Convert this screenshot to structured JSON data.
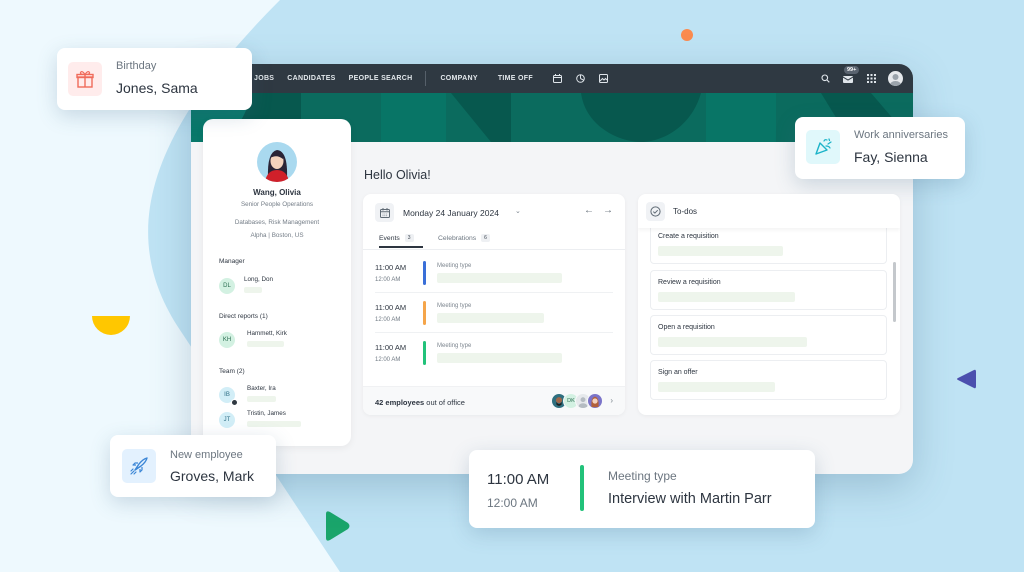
{
  "app": {
    "nav": [
      "JOBS",
      "CANDIDATES",
      "PEOPLE SEARCH",
      "COMPANY",
      "TIME OFF"
    ],
    "nav_icons": [
      "calendar-icon",
      "chart-icon",
      "gallery-icon"
    ],
    "inbox_badge": "99+",
    "colors": {
      "topbar": "#2f3942",
      "banner": "#0b6b5e",
      "event_blue": "#3a6fd8",
      "event_orange": "#f5a54a",
      "event_green": "#22c27a"
    }
  },
  "profile": {
    "name": "Wang, Olivia",
    "title": "Senior People Operations",
    "departments": "Databases, Risk Management",
    "location": "Alpha | Boston, US",
    "manager_label": "Manager",
    "manager": {
      "initials": "DL",
      "name": "Long, Don"
    },
    "direct_reports_label": "Direct reports  (1)",
    "direct_reports": [
      {
        "initials": "KH",
        "name": "Hammett, Kirk"
      }
    ],
    "team_label": "Team (2)",
    "team": [
      {
        "initials": "IB",
        "name": "Baxter, Ira"
      },
      {
        "initials": "JT",
        "name": "Tristin, James"
      }
    ]
  },
  "greeting": "Hello Olivia!",
  "calendar": {
    "date": "Monday 24 January 2024",
    "tabs": [
      {
        "label": "Events",
        "count": "3"
      },
      {
        "label": "Celebrations",
        "count": "6"
      }
    ],
    "events": [
      {
        "start": "11:00 AM",
        "end": "12:00 AM",
        "type": "Meeting type",
        "color": "#3a6fd8"
      },
      {
        "start": "11:00 AM",
        "end": "12:00 AM",
        "type": "Meeting type",
        "color": "#f5a54a"
      },
      {
        "start": "11:00 AM",
        "end": "12:00 AM",
        "type": "Meeting type",
        "color": "#22c27a"
      }
    ],
    "out_of_office_count": "42 employees",
    "out_of_office_suffix": " out of office",
    "ooo_initials": "DK"
  },
  "todos": {
    "title": "To-dos",
    "items": [
      "Create a requisition",
      "Review a requisition",
      "Open a requisition",
      "Sign an offer"
    ]
  },
  "floating": {
    "birthday": {
      "label": "Birthday",
      "value": "Jones, Sama"
    },
    "anniversary": {
      "label": "Work anniversaries",
      "value": "Fay, Sienna"
    },
    "new_employee": {
      "label": "New employee",
      "value": "Groves, Mark"
    },
    "meeting": {
      "start": "11:00 AM",
      "end": "12:00 AM",
      "type": "Meeting type",
      "title": "Interview with Martin Parr"
    }
  }
}
